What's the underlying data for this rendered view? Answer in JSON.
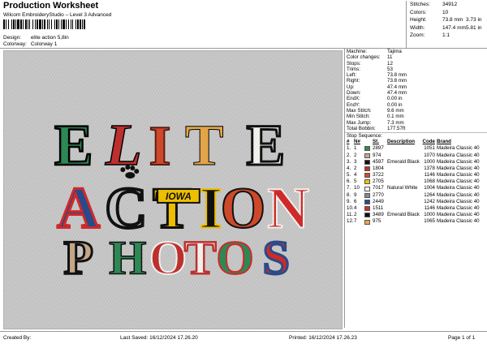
{
  "header": {
    "title": "Production Worksheet",
    "subtitle": "Wilcom EmbroideryStudio – Level 3 Advanced",
    "design_label": "Design:",
    "design_value": "elite action 5,8in",
    "colorway_label": "Colorway:",
    "colorway_value": "Colorway 1"
  },
  "stats": {
    "stitches_label": "Stitches:",
    "stitches_value": "34912",
    "colors_label": "Colors:",
    "colors_value": "10",
    "height_label": "Height:",
    "height_mm": "73.8 mm",
    "height_in": "3.73 in",
    "width_label": "Width:",
    "width_mm": "147.4 mm",
    "width_in": "5.81 in",
    "zoom_label": "Zoom:",
    "zoom_value": "1:1"
  },
  "machine": [
    {
      "label": "Machine:",
      "value": "Tajima"
    },
    {
      "label": "Color changes:",
      "value": "11"
    },
    {
      "label": "Stops:",
      "value": "12"
    },
    {
      "label": "Trims:",
      "value": "53"
    },
    {
      "label": "Left:",
      "value": "73.8 mm"
    },
    {
      "label": "Right:",
      "value": "73.8 mm"
    },
    {
      "label": "Up:",
      "value": "47.4 mm"
    },
    {
      "label": "Down:",
      "value": "47.4 mm"
    },
    {
      "label": "EndX:",
      "value": "0.00 in"
    },
    {
      "label": "EndY:",
      "value": "0.00 in"
    },
    {
      "label": "Max Stitch:",
      "value": "9.6 mm"
    },
    {
      "label": "Min Stitch:",
      "value": "0.1 mm"
    },
    {
      "label": "Max Jump:",
      "value": "7.3 mm"
    },
    {
      "label": "Total Bobbin:",
      "value": "177.57ft"
    }
  ],
  "stop_sequence": {
    "title": "Stop Sequence:",
    "headers": {
      "num": "#",
      "n": "N#",
      "st": "St.",
      "desc": "Description",
      "code": "Code",
      "brand": "Brand"
    },
    "rows": [
      {
        "num": "1.",
        "n": "1",
        "color": "#2e8b57",
        "st": "2897",
        "desc": "",
        "code": "1051",
        "brand": "Madeira Classic 40"
      },
      {
        "num": "2.",
        "n": "2",
        "color": "#c9a98a",
        "st": "974",
        "desc": "",
        "code": "1070",
        "brand": "Madeira Classic 40"
      },
      {
        "num": "3.",
        "n": "3",
        "color": "#111111",
        "st": "4597",
        "desc": "Emerald Black",
        "code": "1000",
        "brand": "Madeira Classic 40"
      },
      {
        "num": "4.",
        "n": "2",
        "color": "#c0312f",
        "st": "1804",
        "desc": "",
        "code": "1378",
        "brand": "Madeira Classic 40"
      },
      {
        "num": "5.",
        "n": "4",
        "color": "#d24a2a",
        "st": "3722",
        "desc": "",
        "code": "1146",
        "brand": "Madeira Classic 40"
      },
      {
        "num": "6.",
        "n": "5",
        "color": "#f2c200",
        "st": "2705",
        "desc": "",
        "code": "1068",
        "brand": "Madeira Classic 40"
      },
      {
        "num": "7.",
        "n": "10",
        "color": "#f4f4f0",
        "st": "7017",
        "desc": "Natural White",
        "code": "1004",
        "brand": "Madeira Classic 40"
      },
      {
        "num": "8.",
        "n": "9",
        "color": "#8a8a8a",
        "st": "2770",
        "desc": "",
        "code": "1264",
        "brand": "Madeira Classic 40"
      },
      {
        "num": "9.",
        "n": "6",
        "color": "#2a4b8d",
        "st": "2449",
        "desc": "",
        "code": "1242",
        "brand": "Madeira Classic 40"
      },
      {
        "num": "10.",
        "n": "4",
        "color": "#d42a2a",
        "st": "1511",
        "desc": "",
        "code": "1146",
        "brand": "Madeira Classic 40"
      },
      {
        "num": "11.",
        "n": "2",
        "color": "#111111",
        "st": "3489",
        "desc": "Emerald Black",
        "code": "1000",
        "brand": "Madeira Classic 40"
      },
      {
        "num": "12.",
        "n": "7",
        "color": "#e8a84a",
        "st": "975",
        "desc": "",
        "code": "1065",
        "brand": "Madeira Classic 40"
      }
    ]
  },
  "design": {
    "row1": [
      "E",
      "L",
      "I",
      "T",
      "E"
    ],
    "row2": [
      "A",
      "C",
      "T",
      "I",
      "O",
      "N"
    ],
    "row2_badge": "IOWA",
    "row3": [
      "P",
      "H",
      "O",
      "T",
      "O",
      "S"
    ]
  },
  "footer": {
    "created_by": "Created By:",
    "last_saved": "Last Saved: 16/12/2024 17.26.20",
    "printed": "Printed: 16/12/2024 17.26.23",
    "page": "Page 1 of 1"
  }
}
